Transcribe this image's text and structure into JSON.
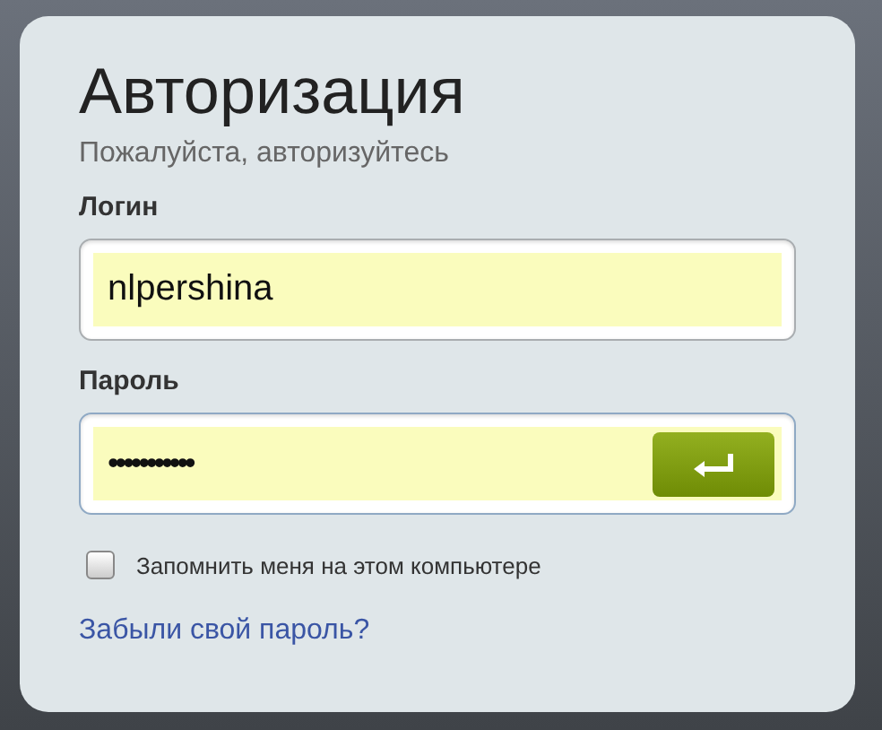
{
  "title": "Авторизация",
  "subtitle": "Пожалуйста, авторизуйтесь",
  "fields": [
    {
      "label": "Логин",
      "value": "nlpershina",
      "kind": "text"
    },
    {
      "label": "Пароль",
      "value": "•••••••••••",
      "kind": "password"
    }
  ],
  "remember": {
    "label": "Запомнить меня на этом компьютере",
    "checked": false
  },
  "forgot_link": "Забыли свой пароль?"
}
